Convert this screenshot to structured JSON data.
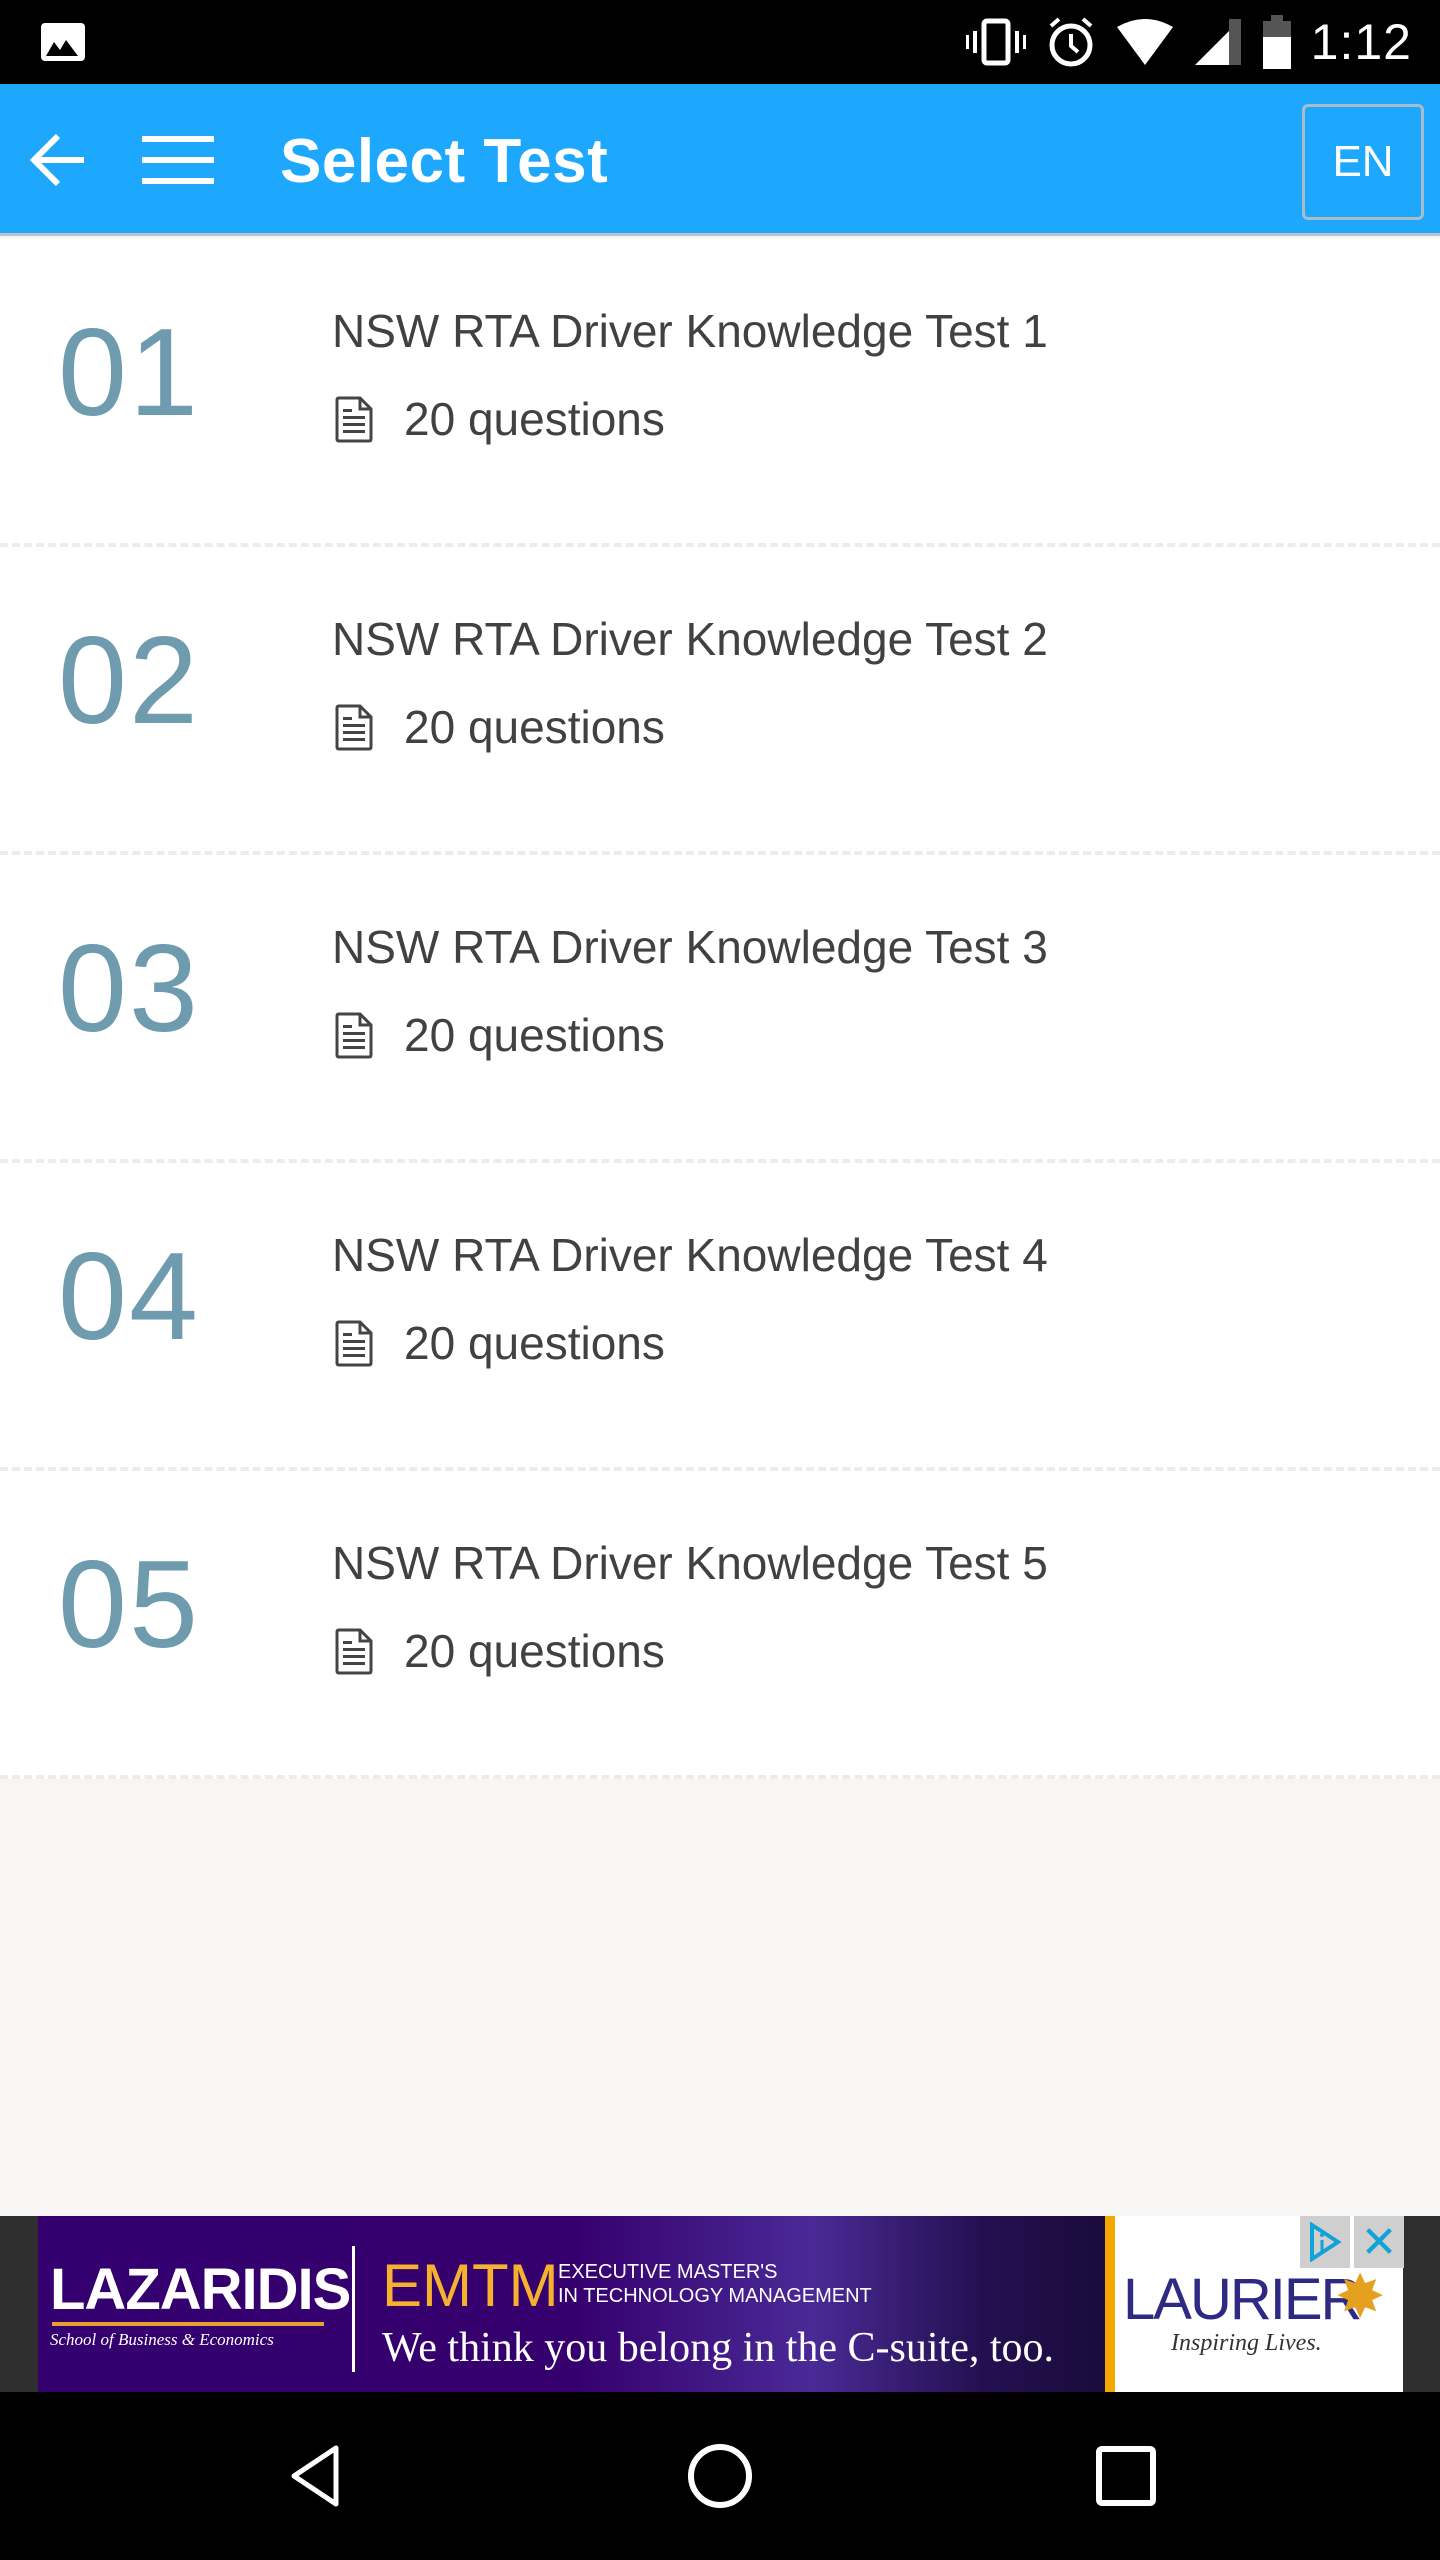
{
  "status_bar": {
    "time": "1:12",
    "icons": [
      "gallery-icon",
      "vibrate-icon",
      "alarm-icon",
      "wifi-icon",
      "signal-icon",
      "battery-icon"
    ]
  },
  "app_bar": {
    "title": "Select Test",
    "back_icon": "arrow-left-icon",
    "menu_icon": "hamburger-menu-icon",
    "language_label": "EN",
    "background_color": "#1da8fd"
  },
  "tests": [
    {
      "number": "01",
      "title": "NSW RTA Driver Knowledge Test 1",
      "questions": "20 questions"
    },
    {
      "number": "02",
      "title": "NSW RTA Driver Knowledge Test 2",
      "questions": "20 questions"
    },
    {
      "number": "03",
      "title": "NSW RTA Driver Knowledge Test 3",
      "questions": "20 questions"
    },
    {
      "number": "04",
      "title": "NSW RTA Driver Knowledge Test 4",
      "questions": "20 questions"
    },
    {
      "number": "05",
      "title": "NSW RTA Driver Knowledge Test 5",
      "questions": "20 questions"
    }
  ],
  "colors": {
    "number": "#6f9bae",
    "text": "#414141"
  },
  "ad": {
    "brand": "LAZARIDIS",
    "brand_sub": "School of Business & Economics",
    "program": "EMTM",
    "program_sub_line1": "EXECUTIVE MASTER'S",
    "program_sub_line2": "IN TECHNOLOGY MANAGEMENT",
    "tagline": "We think you belong in the C-suite, too.",
    "sponsor": "LAURIER",
    "sponsor_tagline": "Inspiring Lives.",
    "close_label": "✕"
  },
  "nav_bar": {
    "buttons": [
      "back-triangle-icon",
      "home-circle-icon",
      "recents-square-icon"
    ]
  }
}
